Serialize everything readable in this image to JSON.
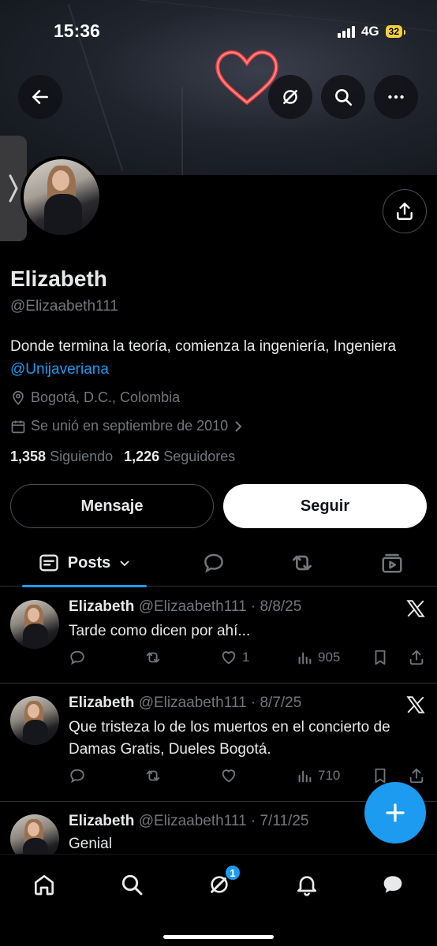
{
  "status_bar": {
    "time": "15:36",
    "network": "4G",
    "battery": "32"
  },
  "profile": {
    "name": "Elizabeth",
    "handle": "@Elizaabeth111",
    "bio_text": "Donde termina la teoría, comienza la ingeniería, Ingeniera ",
    "bio_mention": "@Unijaveriana",
    "location": "Bogotá, D.C., Colombia",
    "joined": "Se unió en septiembre de 2010",
    "following_count": "1,358",
    "following_label": "Siguiendo",
    "followers_count": "1,226",
    "followers_label": "Seguidores"
  },
  "buttons": {
    "message": "Mensaje",
    "follow": "Seguir"
  },
  "tabs": {
    "posts_label": "Posts"
  },
  "posts": [
    {
      "name": "Elizabeth",
      "meta": "@Elizaabeth111 · 8/8/25",
      "text": "Tarde como dicen por ahí...",
      "replies": "",
      "reposts": "",
      "likes": "1",
      "views": "905"
    },
    {
      "name": "Elizabeth",
      "meta": "@Elizaabeth111 · 8/7/25",
      "text": "Que tristeza lo de los muertos en el concierto de Damas Gratis, Dueles Bogotá.",
      "replies": "",
      "reposts": "",
      "likes": "",
      "views": "710"
    },
    {
      "name": "Elizabeth",
      "meta": "@Elizaabeth111 · 7/11/25",
      "text": "Genial"
    }
  ],
  "bottom_nav": {
    "messages_badge": "1"
  },
  "colors": {
    "accent": "#1d9bf0",
    "background": "#000000",
    "secondary_text": "#71767b"
  }
}
